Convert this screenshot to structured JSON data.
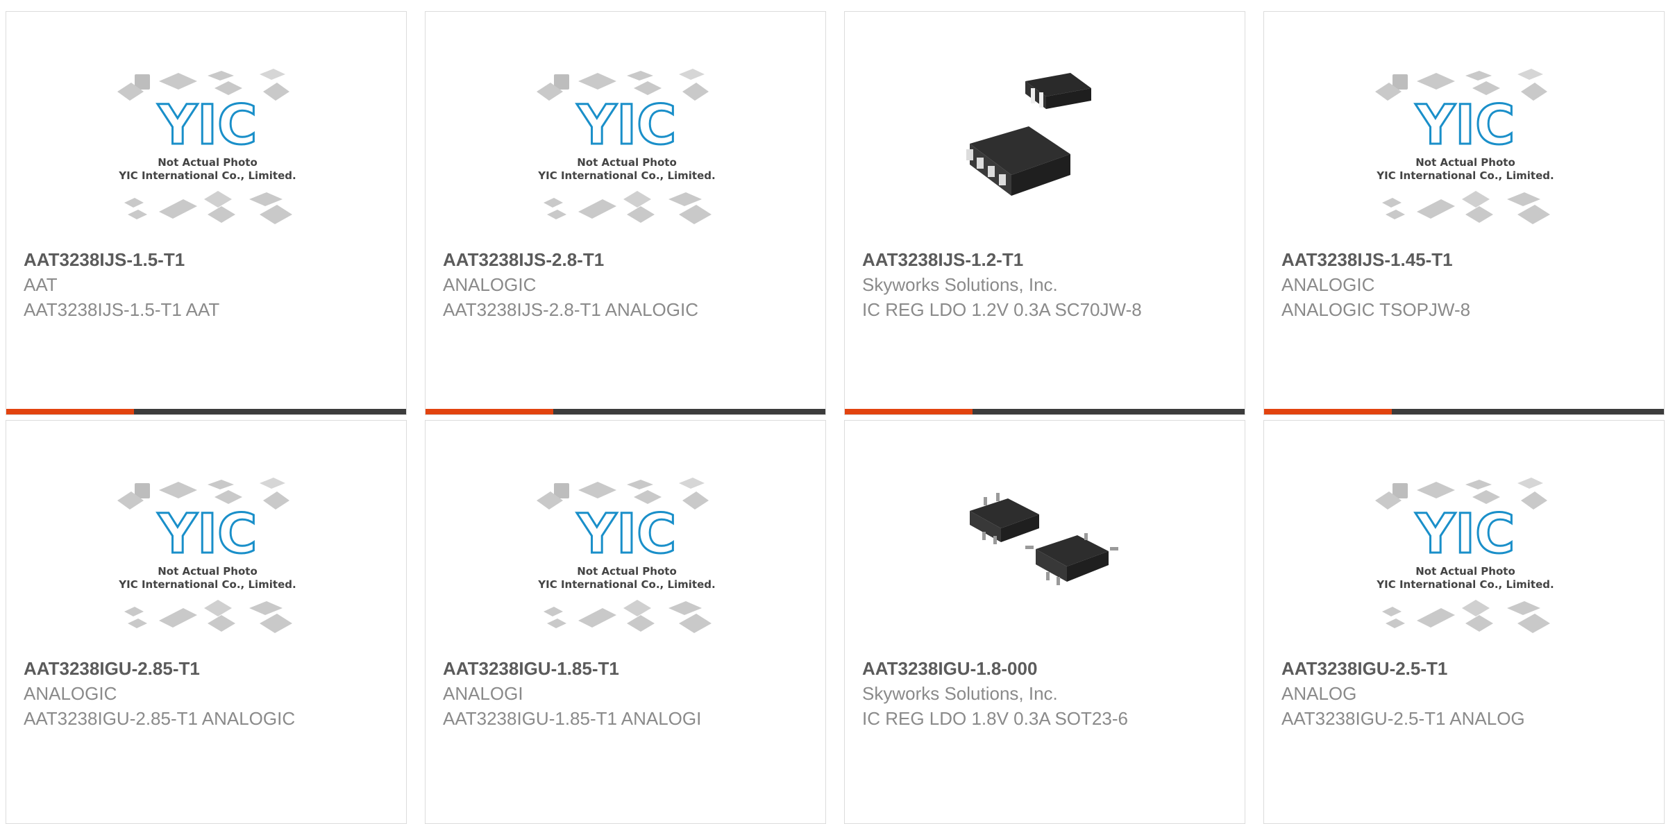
{
  "products": [
    {
      "part_number": "AAT3238IJS-1.5-T1",
      "manufacturer": "AAT",
      "description": "AAT3238IJS-1.5-T1 AAT",
      "image": "placeholder",
      "placeholder_line1": "Not Actual Photo",
      "placeholder_line2": "YIC International Co., Limited.",
      "logo_text": "YIC"
    },
    {
      "part_number": "AAT3238IJS-2.8-T1",
      "manufacturer": "ANALOGIC",
      "description": "AAT3238IJS-2.8-T1 ANALOGIC",
      "image": "placeholder",
      "placeholder_line1": "Not Actual Photo",
      "placeholder_line2": "YIC International Co., Limited.",
      "logo_text": "YIC"
    },
    {
      "part_number": "AAT3238IJS-1.2-T1",
      "manufacturer": "Skyworks Solutions, Inc.",
      "description": "IC REG LDO 1.2V 0.3A SC70JW-8",
      "image": "sc70jw8-photo"
    },
    {
      "part_number": "AAT3238IJS-1.45-T1",
      "manufacturer": "ANALOGIC",
      "description": "ANALOGIC TSOPJW-8",
      "image": "placeholder",
      "placeholder_line1": "Not Actual Photo",
      "placeholder_line2": "YIC International Co., Limited.",
      "logo_text": "YIC"
    },
    {
      "part_number": "AAT3238IGU-2.85-T1",
      "manufacturer": "ANALOGIC",
      "description": "AAT3238IGU-2.85-T1 ANALOGIC",
      "image": "placeholder",
      "placeholder_line1": "Not Actual Photo",
      "placeholder_line2": "YIC International Co., Limited.",
      "logo_text": "YIC"
    },
    {
      "part_number": "AAT3238IGU-1.85-T1",
      "manufacturer": "ANALOGI",
      "description": "AAT3238IGU-1.85-T1 ANALOGI",
      "image": "placeholder",
      "placeholder_line1": "Not Actual Photo",
      "placeholder_line2": "YIC International Co., Limited.",
      "logo_text": "YIC"
    },
    {
      "part_number": "AAT3238IGU-1.8-000",
      "manufacturer": "Skyworks Solutions, Inc.",
      "description": "IC REG LDO 1.8V 0.3A SOT23-6",
      "image": "sot23-6-photo"
    },
    {
      "part_number": "AAT3238IGU-2.5-T1",
      "manufacturer": "ANALOG",
      "description": "AAT3238IGU-2.5-T1 ANALOG",
      "image": "placeholder",
      "placeholder_line1": "Not Actual Photo",
      "placeholder_line2": "YIC International Co., Limited.",
      "logo_text": "YIC"
    }
  ],
  "colors": {
    "accent": "#e2430f",
    "bar": "#3c3c3c",
    "logo_blue": "#1a8fc9",
    "title_text": "#5b5b5b",
    "body_text": "#8a8a8a"
  }
}
